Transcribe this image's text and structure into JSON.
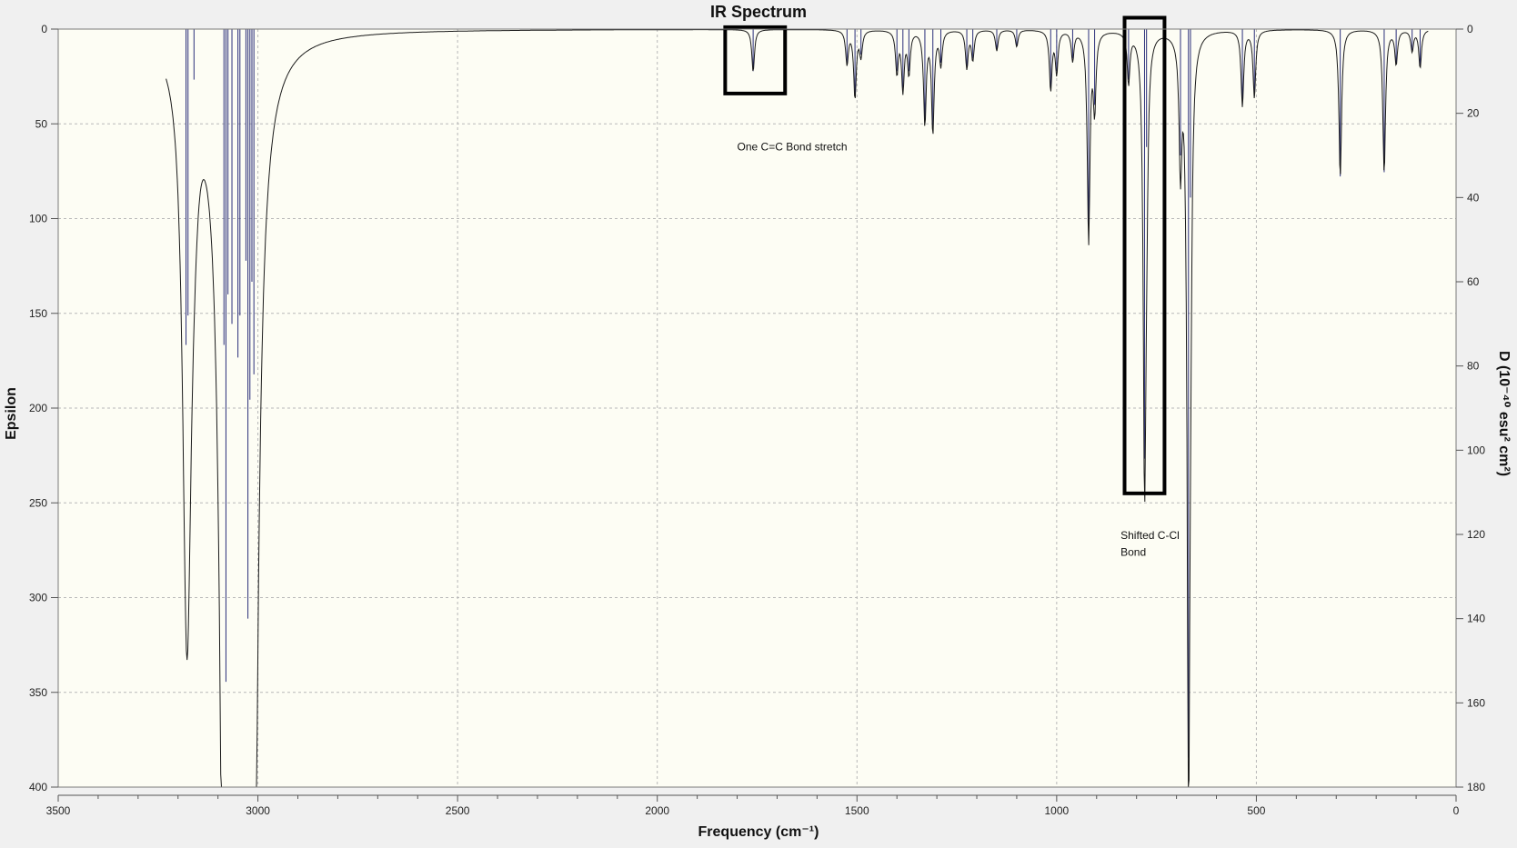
{
  "chart_data": {
    "type": "line",
    "title": "IR Spectrum",
    "xlabel": "Frequency (cm⁻¹)",
    "ylabel": "Epsilon",
    "y2label": "D (10⁻⁴⁰ esu² cm²)",
    "xlim": [
      3500,
      0
    ],
    "ylim": [
      0,
      400
    ],
    "y2lim": [
      0,
      180
    ],
    "x_ticks": [
      "3500",
      "3000",
      "2500",
      "2000",
      "1500",
      "1000",
      "500",
      "0"
    ],
    "x_tick_values": [
      3500,
      3000,
      2500,
      2000,
      1500,
      1000,
      500,
      0
    ],
    "y_ticks": [
      "0",
      "50",
      "100",
      "150",
      "200",
      "250",
      "300",
      "350",
      "400"
    ],
    "y_tick_values": [
      0,
      50,
      100,
      150,
      200,
      250,
      300,
      350,
      400
    ],
    "y2_ticks": [
      "0",
      "20",
      "40",
      "60",
      "80",
      "100",
      "120",
      "140",
      "160",
      "180"
    ],
    "y2_tick_values": [
      0,
      20,
      40,
      60,
      80,
      100,
      120,
      140,
      160,
      180
    ],
    "grid": true,
    "inverted_y": true,
    "colors": {
      "spectrum": "#1a1a1a",
      "sticks": "#2b2f7a",
      "plot_background": "#fdfdf4",
      "frame": "#7a7a7a",
      "box": "#000000"
    },
    "peaks": [
      {
        "x": 3180,
        "d": 75
      },
      {
        "x": 3175,
        "d": 68
      },
      {
        "x": 3160,
        "d": 12
      },
      {
        "x": 3085,
        "d": 75
      },
      {
        "x": 3080,
        "d": 155
      },
      {
        "x": 3075,
        "d": 63
      },
      {
        "x": 3065,
        "d": 70
      },
      {
        "x": 3050,
        "d": 78
      },
      {
        "x": 3045,
        "d": 68
      },
      {
        "x": 3030,
        "d": 55
      },
      {
        "x": 3025,
        "d": 140
      },
      {
        "x": 3020,
        "d": 88
      },
      {
        "x": 3015,
        "d": 60
      },
      {
        "x": 3010,
        "d": 82
      },
      {
        "x": 1760,
        "d": 10
      },
      {
        "x": 1525,
        "d": 8
      },
      {
        "x": 1505,
        "d": 16
      },
      {
        "x": 1490,
        "d": 6
      },
      {
        "x": 1400,
        "d": 10
      },
      {
        "x": 1385,
        "d": 14
      },
      {
        "x": 1370,
        "d": 10
      },
      {
        "x": 1330,
        "d": 22
      },
      {
        "x": 1310,
        "d": 24
      },
      {
        "x": 1290,
        "d": 8
      },
      {
        "x": 1225,
        "d": 9
      },
      {
        "x": 1210,
        "d": 7
      },
      {
        "x": 1150,
        "d": 5
      },
      {
        "x": 1100,
        "d": 4
      },
      {
        "x": 1015,
        "d": 14
      },
      {
        "x": 1000,
        "d": 10
      },
      {
        "x": 960,
        "d": 7
      },
      {
        "x": 920,
        "d": 50
      },
      {
        "x": 905,
        "d": 18
      },
      {
        "x": 820,
        "d": 12
      },
      {
        "x": 780,
        "d": 102
      },
      {
        "x": 775,
        "d": 28
      },
      {
        "x": 690,
        "d": 30
      },
      {
        "x": 670,
        "d": 173
      },
      {
        "x": 665,
        "d": 40
      },
      {
        "x": 535,
        "d": 18
      },
      {
        "x": 505,
        "d": 16
      },
      {
        "x": 290,
        "d": 35
      },
      {
        "x": 180,
        "d": 34
      },
      {
        "x": 150,
        "d": 8
      },
      {
        "x": 110,
        "d": 5
      },
      {
        "x": 90,
        "d": 9
      }
    ],
    "boxes": [
      {
        "x1": 1830,
        "x2": 1680,
        "y1": -1,
        "y2": 34
      },
      {
        "x1": 830,
        "x2": 730,
        "y1": -6,
        "y2": 245
      }
    ],
    "annotations": [
      {
        "text": "One C=C Bond stretch",
        "x": 1800,
        "y": 64
      },
      {
        "text": "Shifted C-Cl",
        "x": 840,
        "y": 269
      },
      {
        "text": "Bond",
        "x": 840,
        "y": 278
      }
    ]
  }
}
